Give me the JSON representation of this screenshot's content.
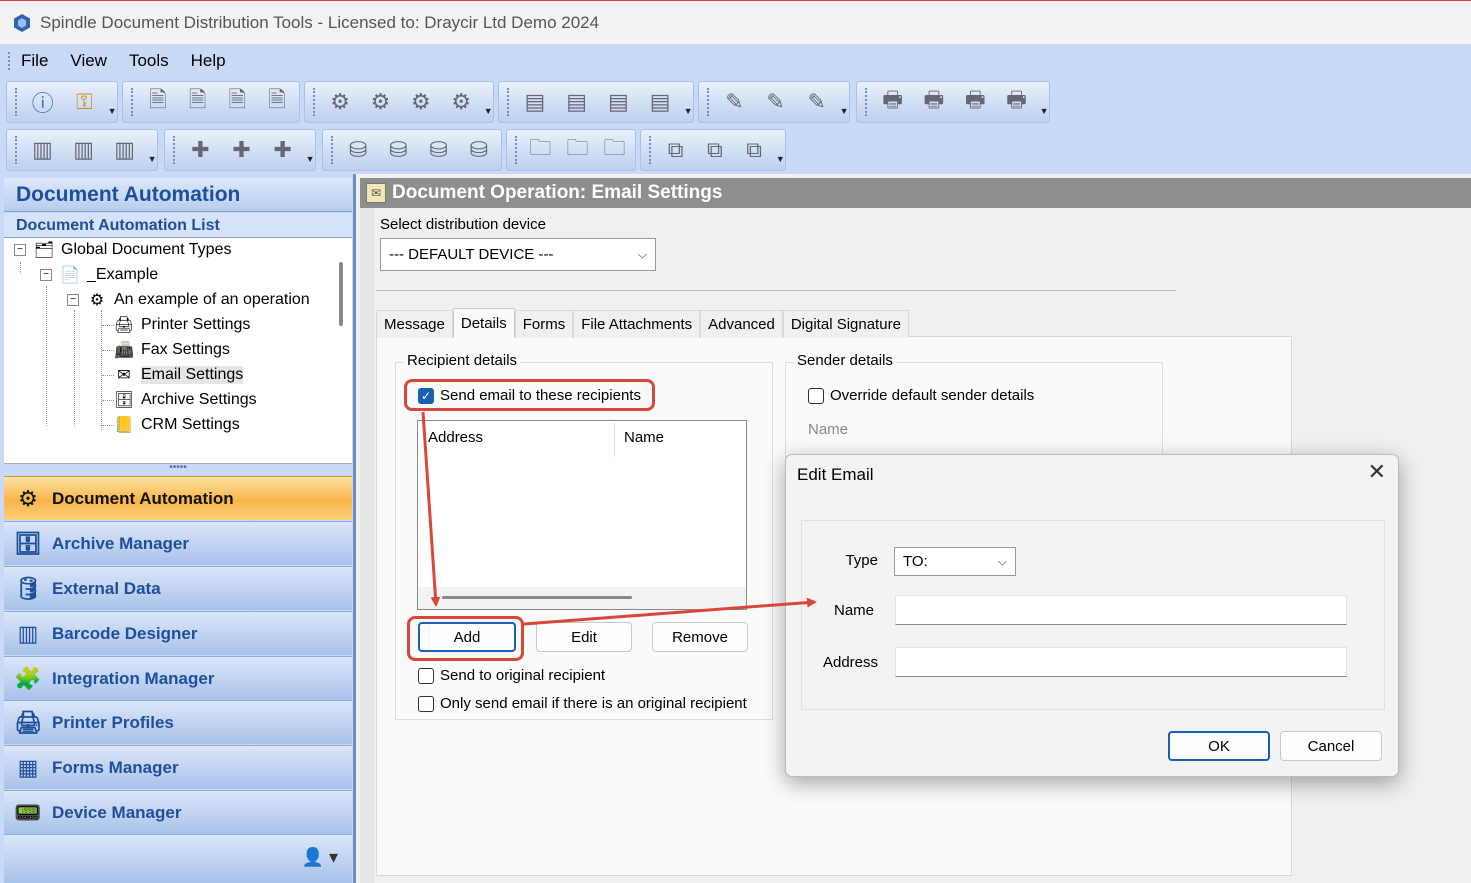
{
  "window": {
    "title": "Spindle Document Distribution Tools - Licensed to: Draycir Ltd Demo 2024"
  },
  "menu": {
    "items": [
      {
        "label": "File",
        "name": "menu-file"
      },
      {
        "label": "View",
        "name": "menu-view"
      },
      {
        "label": "Tools",
        "name": "menu-tools"
      },
      {
        "label": "Help",
        "name": "menu-help"
      }
    ]
  },
  "left": {
    "title": "Document Automation",
    "subtitle": "Document Automation List",
    "tree": [
      {
        "label": "Global Document Types",
        "icon": "folder-gear-icon",
        "glyph": "🗂"
      },
      {
        "label": "_Example",
        "icon": "document-gear-icon",
        "glyph": "📄"
      },
      {
        "label": "An example of an operation",
        "icon": "gear-icon",
        "glyph": "⚙"
      },
      {
        "label": "Printer Settings",
        "icon": "printer-icon",
        "glyph": "🖨"
      },
      {
        "label": "Fax Settings",
        "icon": "fax-icon",
        "glyph": "📠"
      },
      {
        "label": "Email Settings",
        "icon": "envelope-icon",
        "glyph": "✉"
      },
      {
        "label": "Archive Settings",
        "icon": "archive-icon",
        "glyph": "🗄"
      },
      {
        "label": "CRM Settings",
        "icon": "crm-icon",
        "glyph": "📒"
      }
    ],
    "nav": [
      {
        "label": "Document Automation",
        "icon": "gear-icon",
        "glyph": "⚙",
        "active": true
      },
      {
        "label": "Archive Manager",
        "icon": "archive-icon",
        "glyph": "🗄"
      },
      {
        "label": "External Data",
        "icon": "database-icon",
        "glyph": "🛢"
      },
      {
        "label": "Barcode Designer",
        "icon": "barcode-icon",
        "glyph": "▥"
      },
      {
        "label": "Integration Manager",
        "icon": "puzzle-icon",
        "glyph": "🧩"
      },
      {
        "label": "Printer Profiles",
        "icon": "printer-icon",
        "glyph": "🖨"
      },
      {
        "label": "Forms Manager",
        "icon": "form-icon",
        "glyph": "▦"
      },
      {
        "label": "Device Manager",
        "icon": "device-icon",
        "glyph": "📟"
      }
    ]
  },
  "main": {
    "header": "Document Operation: Email Settings",
    "device_label": "Select distribution device",
    "device_value": "--- DEFAULT DEVICE ---",
    "tabs": [
      "Message",
      "Details",
      "Forms",
      "File Attachments",
      "Advanced",
      "Digital Signature"
    ],
    "active_tab": "Details",
    "recipient": {
      "title": "Recipient details",
      "send_checkbox": "Send email to these recipients",
      "col_address": "Address",
      "col_name": "Name",
      "add": "Add",
      "edit": "Edit",
      "remove": "Remove",
      "send_original": "Send to original recipient",
      "only_if_original": "Only send email if there is an original recipient"
    },
    "sender": {
      "title": "Sender details",
      "override": "Override default sender details",
      "name_label": "Name"
    }
  },
  "dialog": {
    "title": "Edit Email",
    "type_label": "Type",
    "type_value": "TO:",
    "name_label": "Name",
    "address_label": "Address",
    "ok": "OK",
    "cancel": "Cancel"
  },
  "colors": {
    "accent": "#1b5fb5",
    "highlight": "#d9473b",
    "nav_active": "#f7b54a",
    "panel_blue": "#c9daf8"
  }
}
